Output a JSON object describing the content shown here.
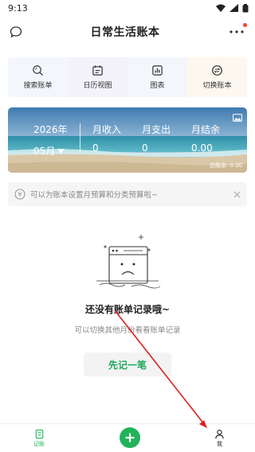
{
  "status_bar": {
    "time": "9:13"
  },
  "header": {
    "title": "日常生活账本"
  },
  "quick_actions": [
    {
      "label": "搜索账单",
      "bg": "#f3f7fc",
      "icon": "search-icon"
    },
    {
      "label": "日历视图",
      "bg": "#f4f3fb",
      "icon": "calendar-icon"
    },
    {
      "label": "图表",
      "bg": "#f3f7fc",
      "icon": "chart-icon"
    },
    {
      "label": "切换账本",
      "bg": "#fdf8ef",
      "icon": "switch-book-icon"
    }
  ],
  "summary": {
    "year": "2026年",
    "month": "05月",
    "income_label": "月收入",
    "expense_label": "月支出",
    "balance_label": "月结余",
    "income_value": "0",
    "expense_value": "0",
    "balance_value": "0.00",
    "total_label": "总结余: 0.00"
  },
  "tip": {
    "text": "可以为账本设置月预算和分类预算啦~"
  },
  "empty_state": {
    "title": "还没有账单记录哦~",
    "subtitle": "可以切换其他月份看看账单记录",
    "button_label": "先记一笔"
  },
  "tabbar": {
    "records_label": "记账",
    "me_label": "我"
  },
  "colors": {
    "accent": "#21b45a",
    "annotation_arrow": "#e02020"
  }
}
